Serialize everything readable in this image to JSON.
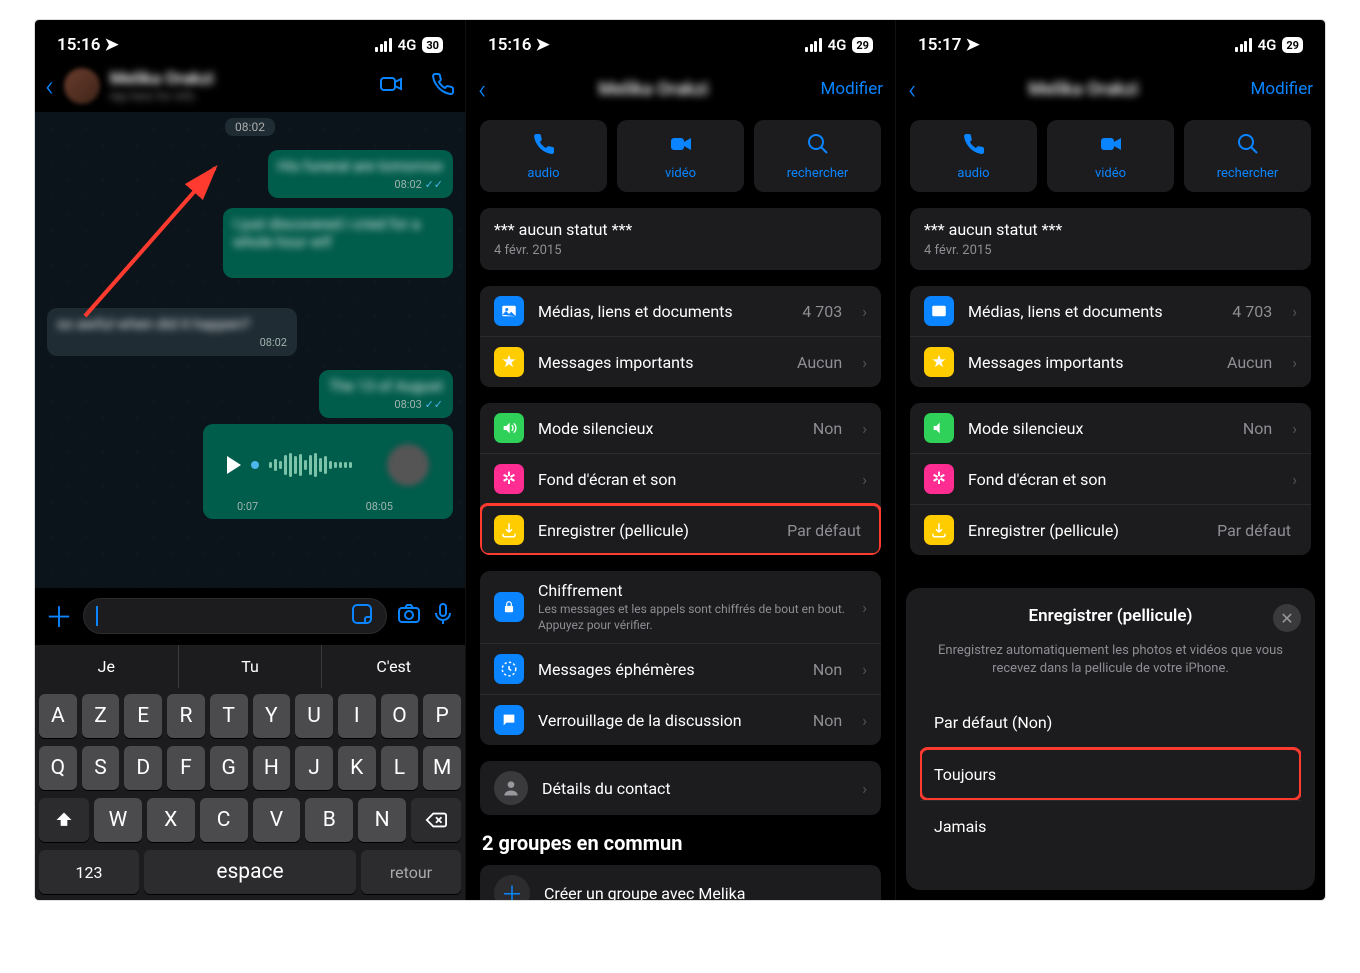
{
  "screen1": {
    "status": {
      "time": "15:16",
      "net": "4G",
      "batt": "30"
    },
    "time_pill": "08:02",
    "bubbles": {
      "out1": {
        "text": "His funeral are tomorrow",
        "time": "08:02"
      },
      "out2": {
        "text": "I just discovered i cried for a whole hour wtf",
        "time": ""
      },
      "in1": {
        "text": "so awful when did it happen?",
        "time": "08:02"
      },
      "out3": {
        "text": "The 13 of August",
        "time": "08:03"
      }
    },
    "voice": {
      "t1": "0:07",
      "t2": "08:05"
    },
    "suggest": [
      "Je",
      "Tu",
      "C'est"
    ],
    "kb": {
      "r1": [
        "A",
        "Z",
        "E",
        "R",
        "T",
        "Y",
        "U",
        "I",
        "O",
        "P"
      ],
      "r2": [
        "Q",
        "S",
        "D",
        "F",
        "G",
        "H",
        "J",
        "K",
        "L",
        "M"
      ],
      "r3": [
        "W",
        "X",
        "C",
        "V",
        "B",
        "N"
      ],
      "num": "123",
      "space": "espace",
      "ret": "retour"
    }
  },
  "screen2": {
    "status": {
      "time": "15:16",
      "net": "4G",
      "batt": "29"
    },
    "edit": "Modifier",
    "title": "Melika Orakzi",
    "tri": {
      "audio": "audio",
      "video": "vidéo",
      "search": "rechercher"
    },
    "statusbox": {
      "line1": "*** aucun statut ***",
      "line2": "4 févr. 2015"
    },
    "rows": {
      "media": {
        "label": "Médias, liens et documents",
        "value": "4 703"
      },
      "starred": {
        "label": "Messages importants",
        "value": "Aucun"
      },
      "mute": {
        "label": "Mode silencieux",
        "value": "Non"
      },
      "wall": {
        "label": "Fond d'écran et son"
      },
      "save": {
        "label": "Enregistrer (pellicule)",
        "value": "Par défaut"
      },
      "enc": {
        "label": "Chiffrement",
        "sub": "Les messages et les appels sont chiffrés de bout en bout. Appuyez pour vérifier."
      },
      "eph": {
        "label": "Messages éphémères",
        "value": "Non"
      },
      "lock": {
        "label": "Verrouillage de la discussion",
        "value": "Non"
      },
      "contact": {
        "label": "Détails du contact"
      }
    },
    "groups_heading": "2 groupes en commun",
    "create_group": "Créer un groupe avec Melika"
  },
  "screen3": {
    "status": {
      "time": "15:17",
      "net": "4G",
      "batt": "29"
    },
    "edit": "Modifier",
    "sheet": {
      "title": "Enregistrer (pellicule)",
      "desc": "Enregistrez automatiquement les photos et vidéos que vous recevez dans la pellicule de votre iPhone.",
      "opt_default": "Par défaut (Non)",
      "opt_always": "Toujours",
      "opt_never": "Jamais"
    }
  }
}
